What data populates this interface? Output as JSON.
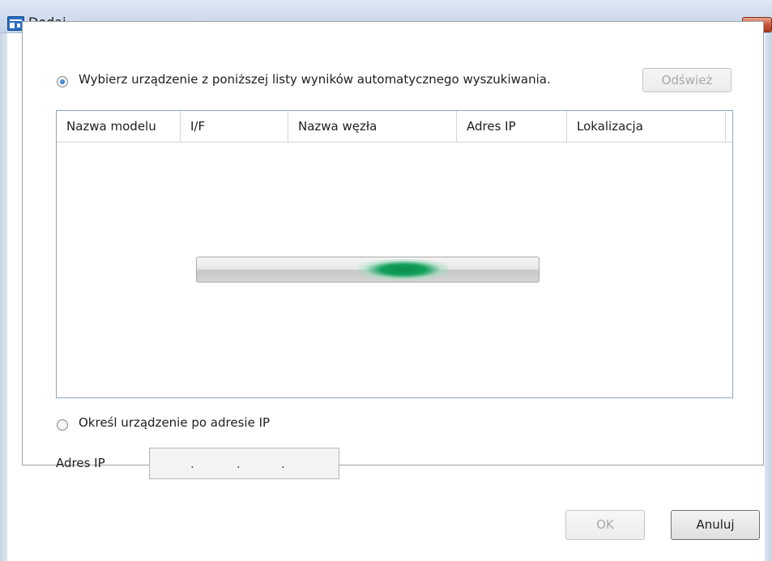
{
  "window": {
    "title": "Dodaj"
  },
  "auto_search": {
    "label": "Wybierz urządzenie z poniższej listy wyników automatycznego wyszukiwania.",
    "selected": true,
    "refresh_label": "Odśwież"
  },
  "device_list": {
    "columns": [
      "Nazwa modelu",
      "I/F",
      "Nazwa węzła",
      "Adres IP",
      "Lokalizacja"
    ],
    "rows": []
  },
  "manual": {
    "label": "Określ urządzenie po adresie IP",
    "selected": false,
    "ip_label": "Adres IP",
    "ip_separators": [
      ".",
      ".",
      "."
    ]
  },
  "footer": {
    "ok_label": "OK",
    "cancel_label": "Anuluj"
  }
}
